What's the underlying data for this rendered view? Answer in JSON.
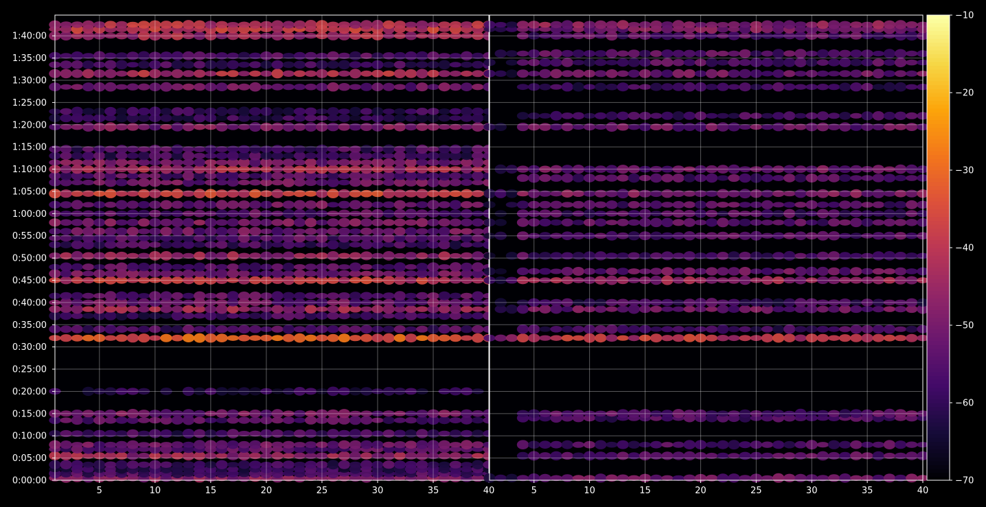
{
  "chart_data": [
    {
      "type": "heatmap",
      "panel": "left",
      "title": "",
      "xlabel": "",
      "ylabel": "",
      "x_range": [
        1,
        40
      ],
      "x_ticks": [
        5,
        10,
        15,
        20,
        25,
        30,
        35,
        40
      ],
      "x_tick_labels": [
        "5",
        "10",
        "15",
        "20",
        "25",
        "30",
        "35",
        "40"
      ],
      "y_range_seconds": [
        0,
        6280
      ],
      "y_tick_labels": [
        "0:00:00",
        "0:05:00",
        "0:10:00",
        "0:15:00",
        "0:20:00",
        "0:25:00",
        "0:30:00",
        "0:35:00",
        "0:40:00",
        "0:45:00",
        "0:50:00",
        "0:55:00",
        "1:00:00",
        "1:05:00",
        "1:10:00",
        "1:15:00",
        "1:20:00",
        "1:25:00",
        "1:30:00",
        "1:35:00",
        "1:40:00"
      ],
      "grid": true,
      "bands": [
        {
          "time": "0:00:30",
          "level": -48
        },
        {
          "time": "0:01:30",
          "level": -57
        },
        {
          "time": "0:02:30",
          "level": -60
        },
        {
          "time": "0:03:30",
          "level": -58
        },
        {
          "time": "0:05:30",
          "level": -45
        },
        {
          "time": "0:07:00",
          "level": -55
        },
        {
          "time": "0:08:00",
          "level": -52
        },
        {
          "time": "0:10:30",
          "level": -58
        },
        {
          "time": "0:13:30",
          "level": -55
        },
        {
          "time": "0:15:00",
          "level": -50
        },
        {
          "time": "0:20:00",
          "level": -62
        },
        {
          "time": "0:32:00",
          "level": -33
        },
        {
          "time": "0:34:00",
          "level": -56
        },
        {
          "time": "0:37:00",
          "level": -58
        },
        {
          "time": "0:38:30",
          "level": -45
        },
        {
          "time": "0:40:00",
          "level": -52
        },
        {
          "time": "0:41:30",
          "level": -55
        },
        {
          "time": "0:45:00",
          "level": -40
        },
        {
          "time": "0:46:30",
          "level": -52
        },
        {
          "time": "0:48:00",
          "level": -55
        },
        {
          "time": "0:50:30",
          "level": -46
        },
        {
          "time": "0:53:00",
          "level": -58
        },
        {
          "time": "0:54:30",
          "level": -55
        },
        {
          "time": "0:56:00",
          "level": -52
        },
        {
          "time": "0:58:00",
          "level": -50
        },
        {
          "time": "1:00:00",
          "level": -55
        },
        {
          "time": "1:02:00",
          "level": -52
        },
        {
          "time": "1:04:30",
          "level": -38
        },
        {
          "time": "1:07:00",
          "level": -52
        },
        {
          "time": "1:08:30",
          "level": -55
        },
        {
          "time": "1:10:00",
          "level": -44
        },
        {
          "time": "1:11:30",
          "level": -50
        },
        {
          "time": "1:13:00",
          "level": -58
        },
        {
          "time": "1:14:30",
          "level": -57
        },
        {
          "time": "1:19:30",
          "level": -50
        },
        {
          "time": "1:21:30",
          "level": -60
        },
        {
          "time": "1:23:00",
          "level": -60
        },
        {
          "time": "1:28:30",
          "level": -52
        },
        {
          "time": "1:31:30",
          "level": -42
        },
        {
          "time": "1:33:30",
          "level": -58
        },
        {
          "time": "1:35:30",
          "level": -56
        },
        {
          "time": "1:40:00",
          "level": -44
        },
        {
          "time": "1:41:30",
          "level": -40
        },
        {
          "time": "1:42:30",
          "level": -42
        }
      ]
    },
    {
      "type": "heatmap",
      "panel": "right",
      "title": "",
      "xlabel": "",
      "ylabel": "",
      "x_range": [
        1,
        40
      ],
      "x_ticks": [
        5,
        10,
        15,
        20,
        25,
        30,
        35,
        40
      ],
      "x_tick_labels": [
        "5",
        "10",
        "15",
        "20",
        "25",
        "30",
        "35",
        "40"
      ],
      "y_range_seconds": [
        0,
        6280
      ],
      "grid": true,
      "bands": [
        {
          "time": "0:00:30",
          "level": -52
        },
        {
          "time": "0:05:30",
          "level": -55
        },
        {
          "time": "0:08:00",
          "level": -56
        },
        {
          "time": "0:14:00",
          "level": -56
        },
        {
          "time": "0:15:00",
          "level": -55
        },
        {
          "time": "0:32:00",
          "level": -40
        },
        {
          "time": "0:34:00",
          "level": -58
        },
        {
          "time": "0:38:30",
          "level": -52
        },
        {
          "time": "0:40:00",
          "level": -58
        },
        {
          "time": "0:45:00",
          "level": -46
        },
        {
          "time": "0:47:00",
          "level": -52
        },
        {
          "time": "0:50:30",
          "level": -56
        },
        {
          "time": "0:55:00",
          "level": -55
        },
        {
          "time": "0:58:00",
          "level": -55
        },
        {
          "time": "1:00:00",
          "level": -56
        },
        {
          "time": "1:02:00",
          "level": -55
        },
        {
          "time": "1:04:30",
          "level": -50
        },
        {
          "time": "1:08:00",
          "level": -55
        },
        {
          "time": "1:10:00",
          "level": -52
        },
        {
          "time": "1:19:30",
          "level": -52
        },
        {
          "time": "1:22:00",
          "level": -58
        },
        {
          "time": "1:28:30",
          "level": -58
        },
        {
          "time": "1:31:30",
          "level": -52
        },
        {
          "time": "1:34:00",
          "level": -56
        },
        {
          "time": "1:36:00",
          "level": -55
        },
        {
          "time": "1:40:00",
          "level": -55
        },
        {
          "time": "1:41:30",
          "level": -50
        },
        {
          "time": "1:42:30",
          "level": -48
        }
      ]
    },
    {
      "type": "colorbar",
      "colormap": "inferno",
      "range": [
        -70,
        -10
      ],
      "ticks": [
        -70,
        -60,
        -50,
        -40,
        -30,
        -20,
        -10
      ],
      "tick_labels": [
        "−70",
        "−60",
        "−50",
        "−40",
        "−30",
        "−20",
        "−10"
      ]
    }
  ],
  "colors": {
    "background": "#000000",
    "axes_face": "#000004",
    "grid": "#ffffff",
    "text": "#ffffff"
  }
}
